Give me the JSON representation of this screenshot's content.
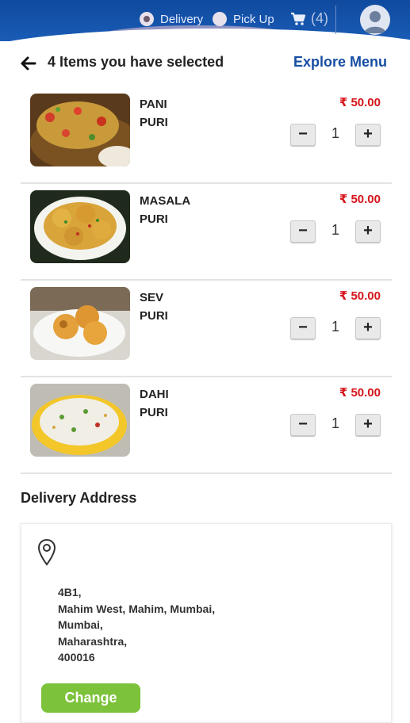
{
  "header": {
    "delivery_label": "Delivery",
    "pickup_label": "Pick Up",
    "delivery_selected": true,
    "cart_count": "(4)",
    "colors": {
      "bar": "#1a5cb6",
      "accent_price": "#d6141a",
      "link": "#174ea3",
      "change_button": "#7cc23a"
    }
  },
  "page": {
    "title": "4 Items you have selected",
    "explore_label": "Explore Menu"
  },
  "items": [
    {
      "name_line1": "PANI",
      "name_line2": "PURI",
      "price": "₹ 50.00",
      "qty": "1",
      "image": "pani-puri-photo"
    },
    {
      "name_line1": "MASALA",
      "name_line2": "PURI",
      "price": "₹ 50.00",
      "qty": "1",
      "image": "masala-puri-photo"
    },
    {
      "name_line1": "SEV",
      "name_line2": "PURI",
      "price": "₹ 50.00",
      "qty": "1",
      "image": "sev-puri-photo"
    },
    {
      "name_line1": "DAHI",
      "name_line2": "PURI",
      "price": "₹ 50.00",
      "qty": "1",
      "image": "dahi-puri-photo"
    }
  ],
  "qty_controls": {
    "minus": "−",
    "plus": "+"
  },
  "address": {
    "heading": "Delivery Address",
    "line1": "4B1,",
    "line2": "Mahim West, Mahim, Mumbai,",
    "line3": "Mumbai,",
    "line4": "Maharashtra,",
    "line5": "400016",
    "change_label": "Change"
  }
}
